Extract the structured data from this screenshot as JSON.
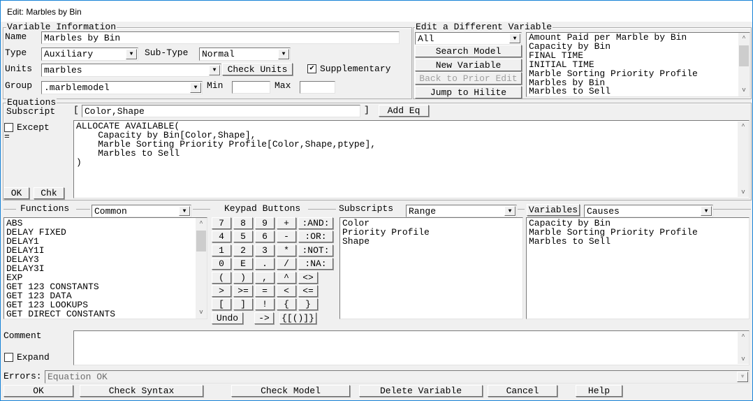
{
  "window": {
    "title": "Edit: Marbles by Bin"
  },
  "var_info": {
    "legend": "Variable Information",
    "name_label": "Name",
    "name": "Marbles by Bin",
    "type_label": "Type",
    "type": "Auxiliary",
    "subtype_label": "Sub-Type",
    "subtype": "Normal",
    "units_label": "Units",
    "units": "marbles",
    "check_units": "Check Units",
    "supplementary": "Supplementary",
    "supplementary_checked": true,
    "group_label": "Group",
    "group": ".marblemodel",
    "min_label": "Min",
    "min": "",
    "max_label": "Max",
    "max": ""
  },
  "edit_other": {
    "legend": "Edit a Different Variable",
    "filter": "All",
    "search": "Search Model",
    "new": "New Variable",
    "back": "Back to Prior Edit",
    "jump": "Jump to Hilite",
    "items": [
      "Amount Paid per Marble by Bin",
      "Capacity by Bin",
      "FINAL TIME",
      "INITIAL TIME",
      "Marble Sorting Priority Profile",
      "Marbles by Bin",
      "Marbles to Sell"
    ]
  },
  "equations": {
    "legend": "Equations",
    "subscript_label": "Subscript",
    "open_bracket": "[",
    "subscript": "Color,Shape",
    "close_bracket": "]",
    "add_eq": "Add Eq",
    "except": "Except",
    "equals": "=",
    "text": "ALLOCATE AVAILABLE(\n    Capacity by Bin[Color,Shape],\n    Marble Sorting Priority Profile[Color,Shape,ptype],\n    Marbles to Sell\n)",
    "ok": "OK",
    "chk": "Chk"
  },
  "functions": {
    "label": "Functions",
    "category": "Common",
    "items": [
      "ABS",
      "DELAY FIXED",
      "DELAY1",
      "DELAY1I",
      "DELAY3",
      "DELAY3I",
      "EXP",
      "GET 123 CONSTANTS",
      "GET 123 DATA",
      "GET 123 LOOKUPS",
      "GET DIRECT CONSTANTS"
    ]
  },
  "keypad": {
    "label": "Keypad Buttons",
    "rows": [
      [
        "7",
        "8",
        "9",
        "+",
        ":AND:"
      ],
      [
        "4",
        "5",
        "6",
        "-",
        ":OR:"
      ],
      [
        "1",
        "2",
        "3",
        "*",
        ":NOT:"
      ],
      [
        "0",
        "E",
        ".",
        "/",
        ":NA:"
      ],
      [
        "(",
        ")",
        ",",
        "^",
        "<>"
      ],
      [
        ">",
        ">=",
        "=",
        "<",
        "<="
      ],
      [
        "[",
        "]",
        "!",
        "{",
        "}"
      ]
    ],
    "undo": "Undo",
    "arrow": "->",
    "brackets": "{[()]}"
  },
  "subscripts": {
    "label": "Subscripts",
    "mode": "Range",
    "items": [
      "Color",
      "Priority Profile",
      "Shape"
    ]
  },
  "variables": {
    "button": "Variables",
    "mode": "Causes",
    "items": [
      "Capacity by Bin",
      "Marble Sorting Priority Profile",
      "Marbles to Sell"
    ]
  },
  "comment": {
    "label": "Comment",
    "expand": "Expand",
    "text": ""
  },
  "errors": {
    "label": "Errors:",
    "text": "Equation OK"
  },
  "footer": {
    "ok": "OK",
    "check_syntax": "Check Syntax",
    "check_model": "Check Model",
    "delete": "Delete Variable",
    "cancel": "Cancel",
    "help": "Help"
  }
}
